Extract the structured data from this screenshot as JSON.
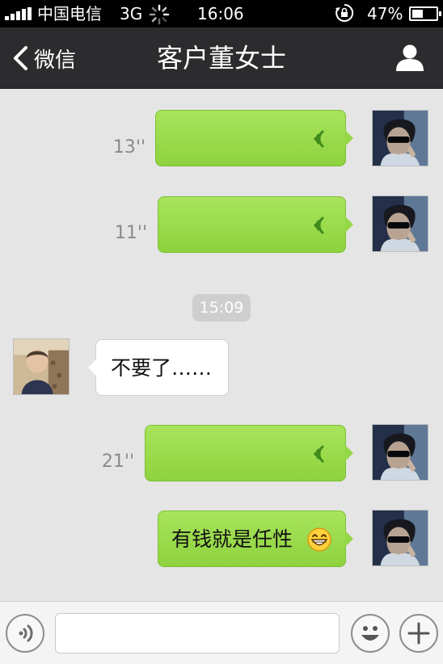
{
  "status_bar": {
    "carrier": "中国电信",
    "network": "3G",
    "time": "16:06",
    "battery_percent_label": "47%",
    "battery_level": 0.47
  },
  "nav": {
    "back_label": "微信",
    "title": "客户董女士"
  },
  "messages": [
    {
      "side": "right",
      "type": "voice",
      "duration": "13''"
    },
    {
      "side": "right",
      "type": "voice",
      "duration": "11''"
    },
    {
      "type": "timestamp",
      "text": "15:09"
    },
    {
      "side": "left",
      "type": "text",
      "text": "不要了……"
    },
    {
      "side": "right",
      "type": "voice",
      "duration": "21''"
    },
    {
      "side": "right",
      "type": "text",
      "text": "有钱就是任性"
    }
  ],
  "colors": {
    "bubble_green": "#95d646",
    "chat_background": "#e5e5e5",
    "nav_background": "#2c2c2e"
  }
}
